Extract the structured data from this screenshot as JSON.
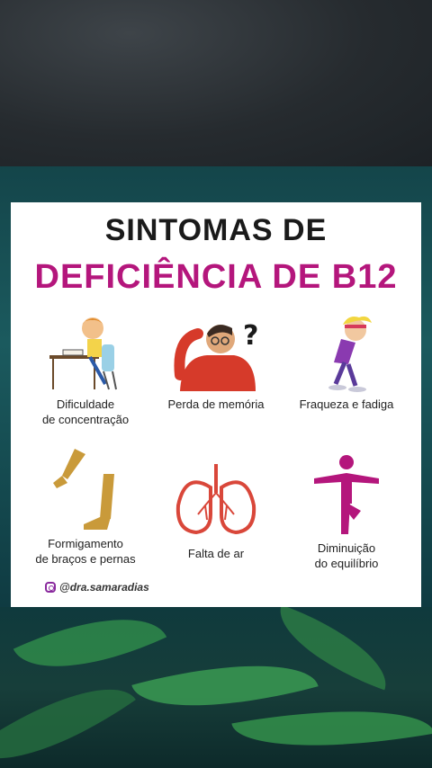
{
  "title_line1": "SINTOMAS DE",
  "title_line2": "DEFICIÊNCIA DE B12",
  "symptoms": [
    {
      "label_l1": "Dificuldade",
      "label_l2": "de concentração",
      "icon": "studying-child-icon"
    },
    {
      "label_l1": "Perda de memória",
      "label_l2": "",
      "icon": "confused-man-icon"
    },
    {
      "label_l1": "Fraqueza e fadiga",
      "label_l2": "",
      "icon": "tired-runner-icon"
    },
    {
      "label_l1": "Formigamento",
      "label_l2": "de braços e pernas",
      "icon": "arm-leg-icon"
    },
    {
      "label_l1": "Falta de ar",
      "label_l2": "",
      "icon": "lungs-icon"
    },
    {
      "label_l1": "Diminuição",
      "label_l2": "do equilíbrio",
      "icon": "balance-figure-icon"
    }
  ],
  "handle": "@dra.samaradias",
  "colors": {
    "accent": "#b4167c",
    "title": "#1a1a1a",
    "lungs": "#d9473a",
    "figure": "#b4167c",
    "limb": "#c99a3a"
  }
}
